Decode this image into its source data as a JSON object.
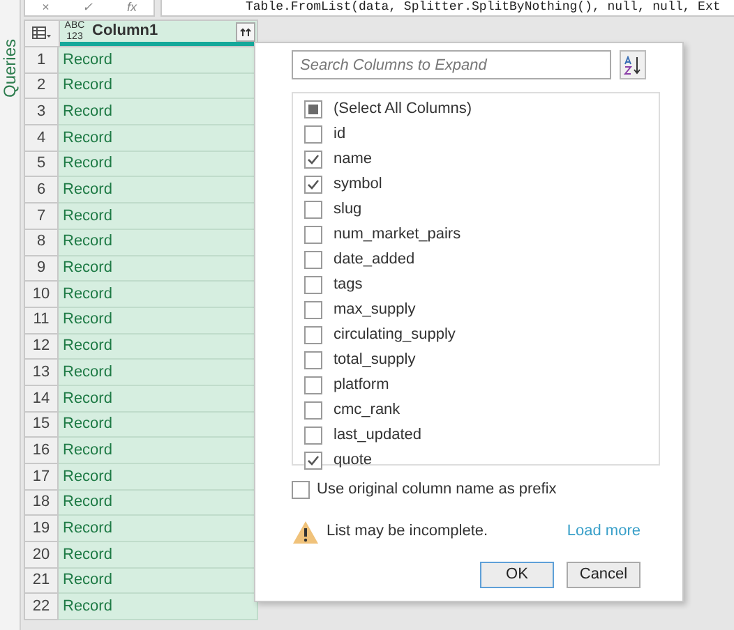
{
  "sidebar": {
    "label": "Queries"
  },
  "formula_bar": {
    "buttons": [
      "×",
      "✓",
      "fx"
    ],
    "formula": "Table.FromList(data, Splitter.SplitByNothing(), null, null, Ext"
  },
  "table": {
    "type_label": "ABC 123",
    "column": "Column1",
    "rows": [
      {
        "number": "1",
        "value": "Record"
      },
      {
        "number": "2",
        "value": "Record"
      },
      {
        "number": "3",
        "value": "Record"
      },
      {
        "number": "4",
        "value": "Record"
      },
      {
        "number": "5",
        "value": "Record"
      },
      {
        "number": "6",
        "value": "Record"
      },
      {
        "number": "7",
        "value": "Record"
      },
      {
        "number": "8",
        "value": "Record"
      },
      {
        "number": "9",
        "value": "Record"
      },
      {
        "number": "10",
        "value": "Record"
      },
      {
        "number": "11",
        "value": "Record"
      },
      {
        "number": "12",
        "value": "Record"
      },
      {
        "number": "13",
        "value": "Record"
      },
      {
        "number": "14",
        "value": "Record"
      },
      {
        "number": "15",
        "value": "Record"
      },
      {
        "number": "16",
        "value": "Record"
      },
      {
        "number": "17",
        "value": "Record"
      },
      {
        "number": "18",
        "value": "Record"
      },
      {
        "number": "19",
        "value": "Record"
      },
      {
        "number": "20",
        "value": "Record"
      },
      {
        "number": "21",
        "value": "Record"
      },
      {
        "number": "22",
        "value": "Record"
      }
    ]
  },
  "expand_popup": {
    "search": {
      "placeholder": "Search Columns to Expand"
    },
    "select_all": {
      "label": "(Select All Columns)",
      "partial": true
    },
    "columns": [
      {
        "label": "id",
        "checked": false
      },
      {
        "label": "name",
        "checked": true
      },
      {
        "label": "symbol",
        "checked": true
      },
      {
        "label": "slug",
        "checked": false
      },
      {
        "label": "num_market_pairs",
        "checked": false
      },
      {
        "label": "date_added",
        "checked": false
      },
      {
        "label": "tags",
        "checked": false
      },
      {
        "label": "max_supply",
        "checked": false
      },
      {
        "label": "circulating_supply",
        "checked": false
      },
      {
        "label": "total_supply",
        "checked": false
      },
      {
        "label": "platform",
        "checked": false
      },
      {
        "label": "cmc_rank",
        "checked": false
      },
      {
        "label": "last_updated",
        "checked": false
      },
      {
        "label": "quote",
        "checked": true
      }
    ],
    "prefix": {
      "label": "Use original column name as prefix",
      "checked": false
    },
    "warning": "List may be incomplete.",
    "load_more": "Load more",
    "buttons": [
      "OK",
      "Cancel"
    ]
  }
}
